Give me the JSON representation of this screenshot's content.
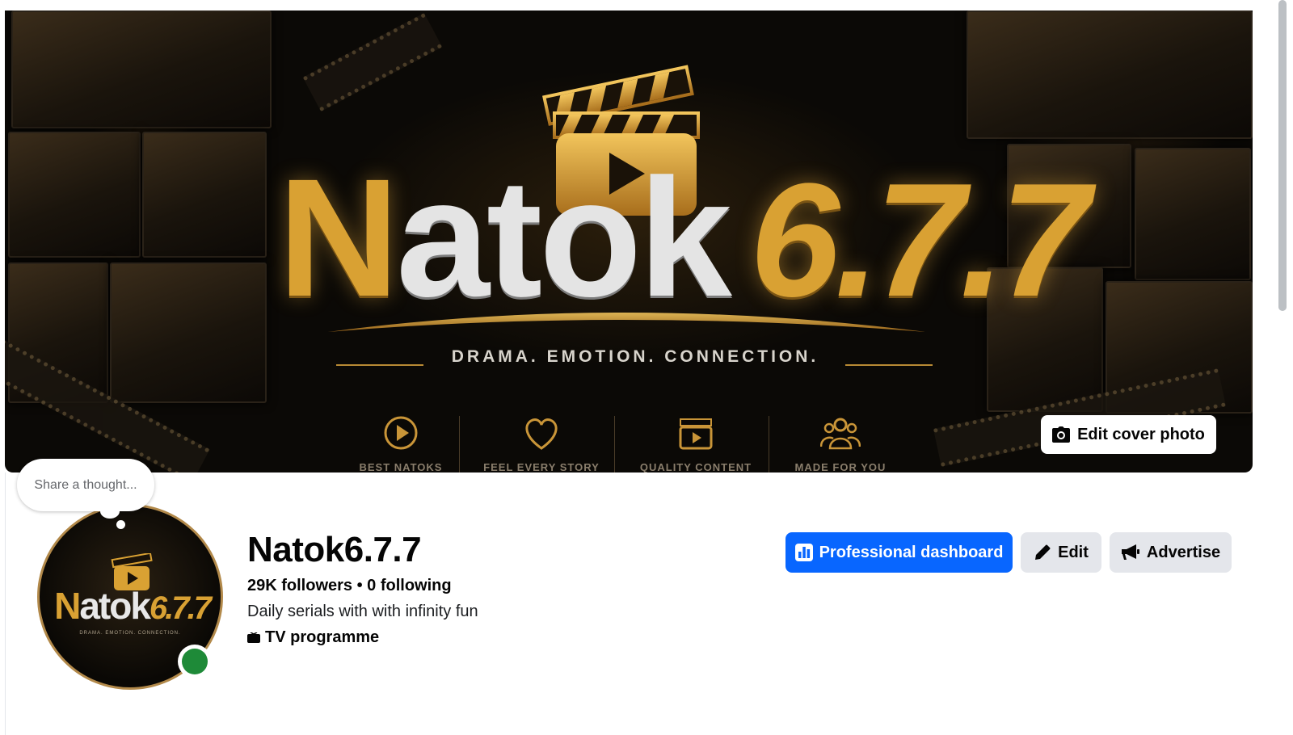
{
  "cover": {
    "brand_word": "Natok",
    "brand_number": "6.7.7",
    "tagline": "DRAMA. EMOTION. CONNECTION.",
    "features": [
      {
        "label": "BEST NATOKS",
        "icon": "play-circle-icon"
      },
      {
        "label": "FEEL EVERY STORY",
        "icon": "heart-icon"
      },
      {
        "label": "QUALITY CONTENT",
        "icon": "clapperboard-icon"
      },
      {
        "label": "MADE FOR YOU",
        "icon": "people-icon"
      }
    ],
    "edit_cover_label": "Edit cover photo"
  },
  "thought_bubble": {
    "placeholder": "Share a thought..."
  },
  "avatar": {
    "brand_word": "Natok",
    "brand_number": "6.7.7",
    "tagline": "DRAMA. EMOTION. CONNECTION."
  },
  "profile": {
    "name": "Natok6.7.7",
    "followers_line": "29K followers • 0 following",
    "bio": "Daily serials with with infinity fun",
    "category": "TV programme"
  },
  "actions": {
    "professional_dashboard": "Professional dashboard",
    "edit": "Edit",
    "advertise": "Advertise"
  },
  "colors": {
    "primary_blue": "#0866ff",
    "secondary_button": "#e4e6eb",
    "brand_gold": "#d9a133",
    "online_green": "#1e8a38"
  }
}
